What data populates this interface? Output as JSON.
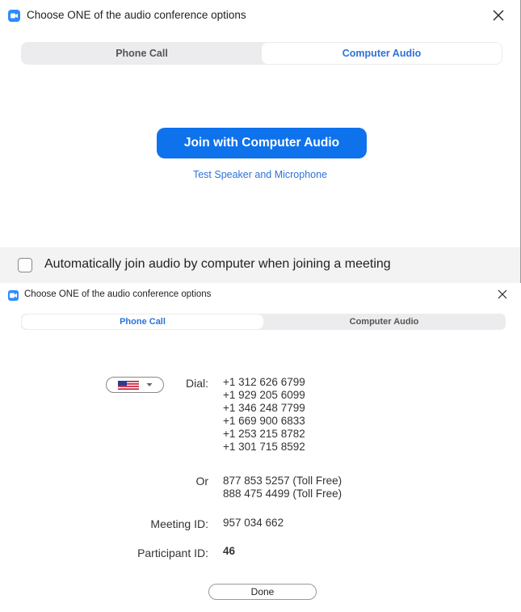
{
  "top_dialog": {
    "title": "Choose ONE of the audio conference options",
    "tabs": [
      {
        "label": "Phone Call",
        "active": false
      },
      {
        "label": "Computer Audio",
        "active": true
      }
    ],
    "join_button": "Join with Computer Audio",
    "test_link": "Test Speaker and Microphone",
    "auto_join_label": "Automatically join audio by computer when joining a meeting",
    "auto_join_checked": false
  },
  "bottom_dialog": {
    "title": "Choose ONE of the audio conference options",
    "tabs": [
      {
        "label": "Phone Call",
        "active": true
      },
      {
        "label": "Computer Audio",
        "active": false
      }
    ],
    "country_selector": "us-flag-icon",
    "dial_label": "Dial:",
    "dial_numbers": [
      "+1 312 626 6799",
      "+1 929 205 6099",
      "+1 346 248 7799",
      "+1 669 900 6833",
      "+1 253 215 8782",
      "+1 301 715 8592"
    ],
    "or_label": "Or",
    "toll_free_numbers": [
      "877 853 5257 (Toll Free)",
      "888 475 4499 (Toll Free)"
    ],
    "meeting_id_label": "Meeting ID:",
    "meeting_id": "957 034 662",
    "participant_id_label": "Participant ID:",
    "participant_id": "46",
    "done_button": "Done"
  },
  "colors": {
    "accent": "#0e72ed",
    "link": "#2d72d9",
    "app_icon": "#2d8cff"
  }
}
